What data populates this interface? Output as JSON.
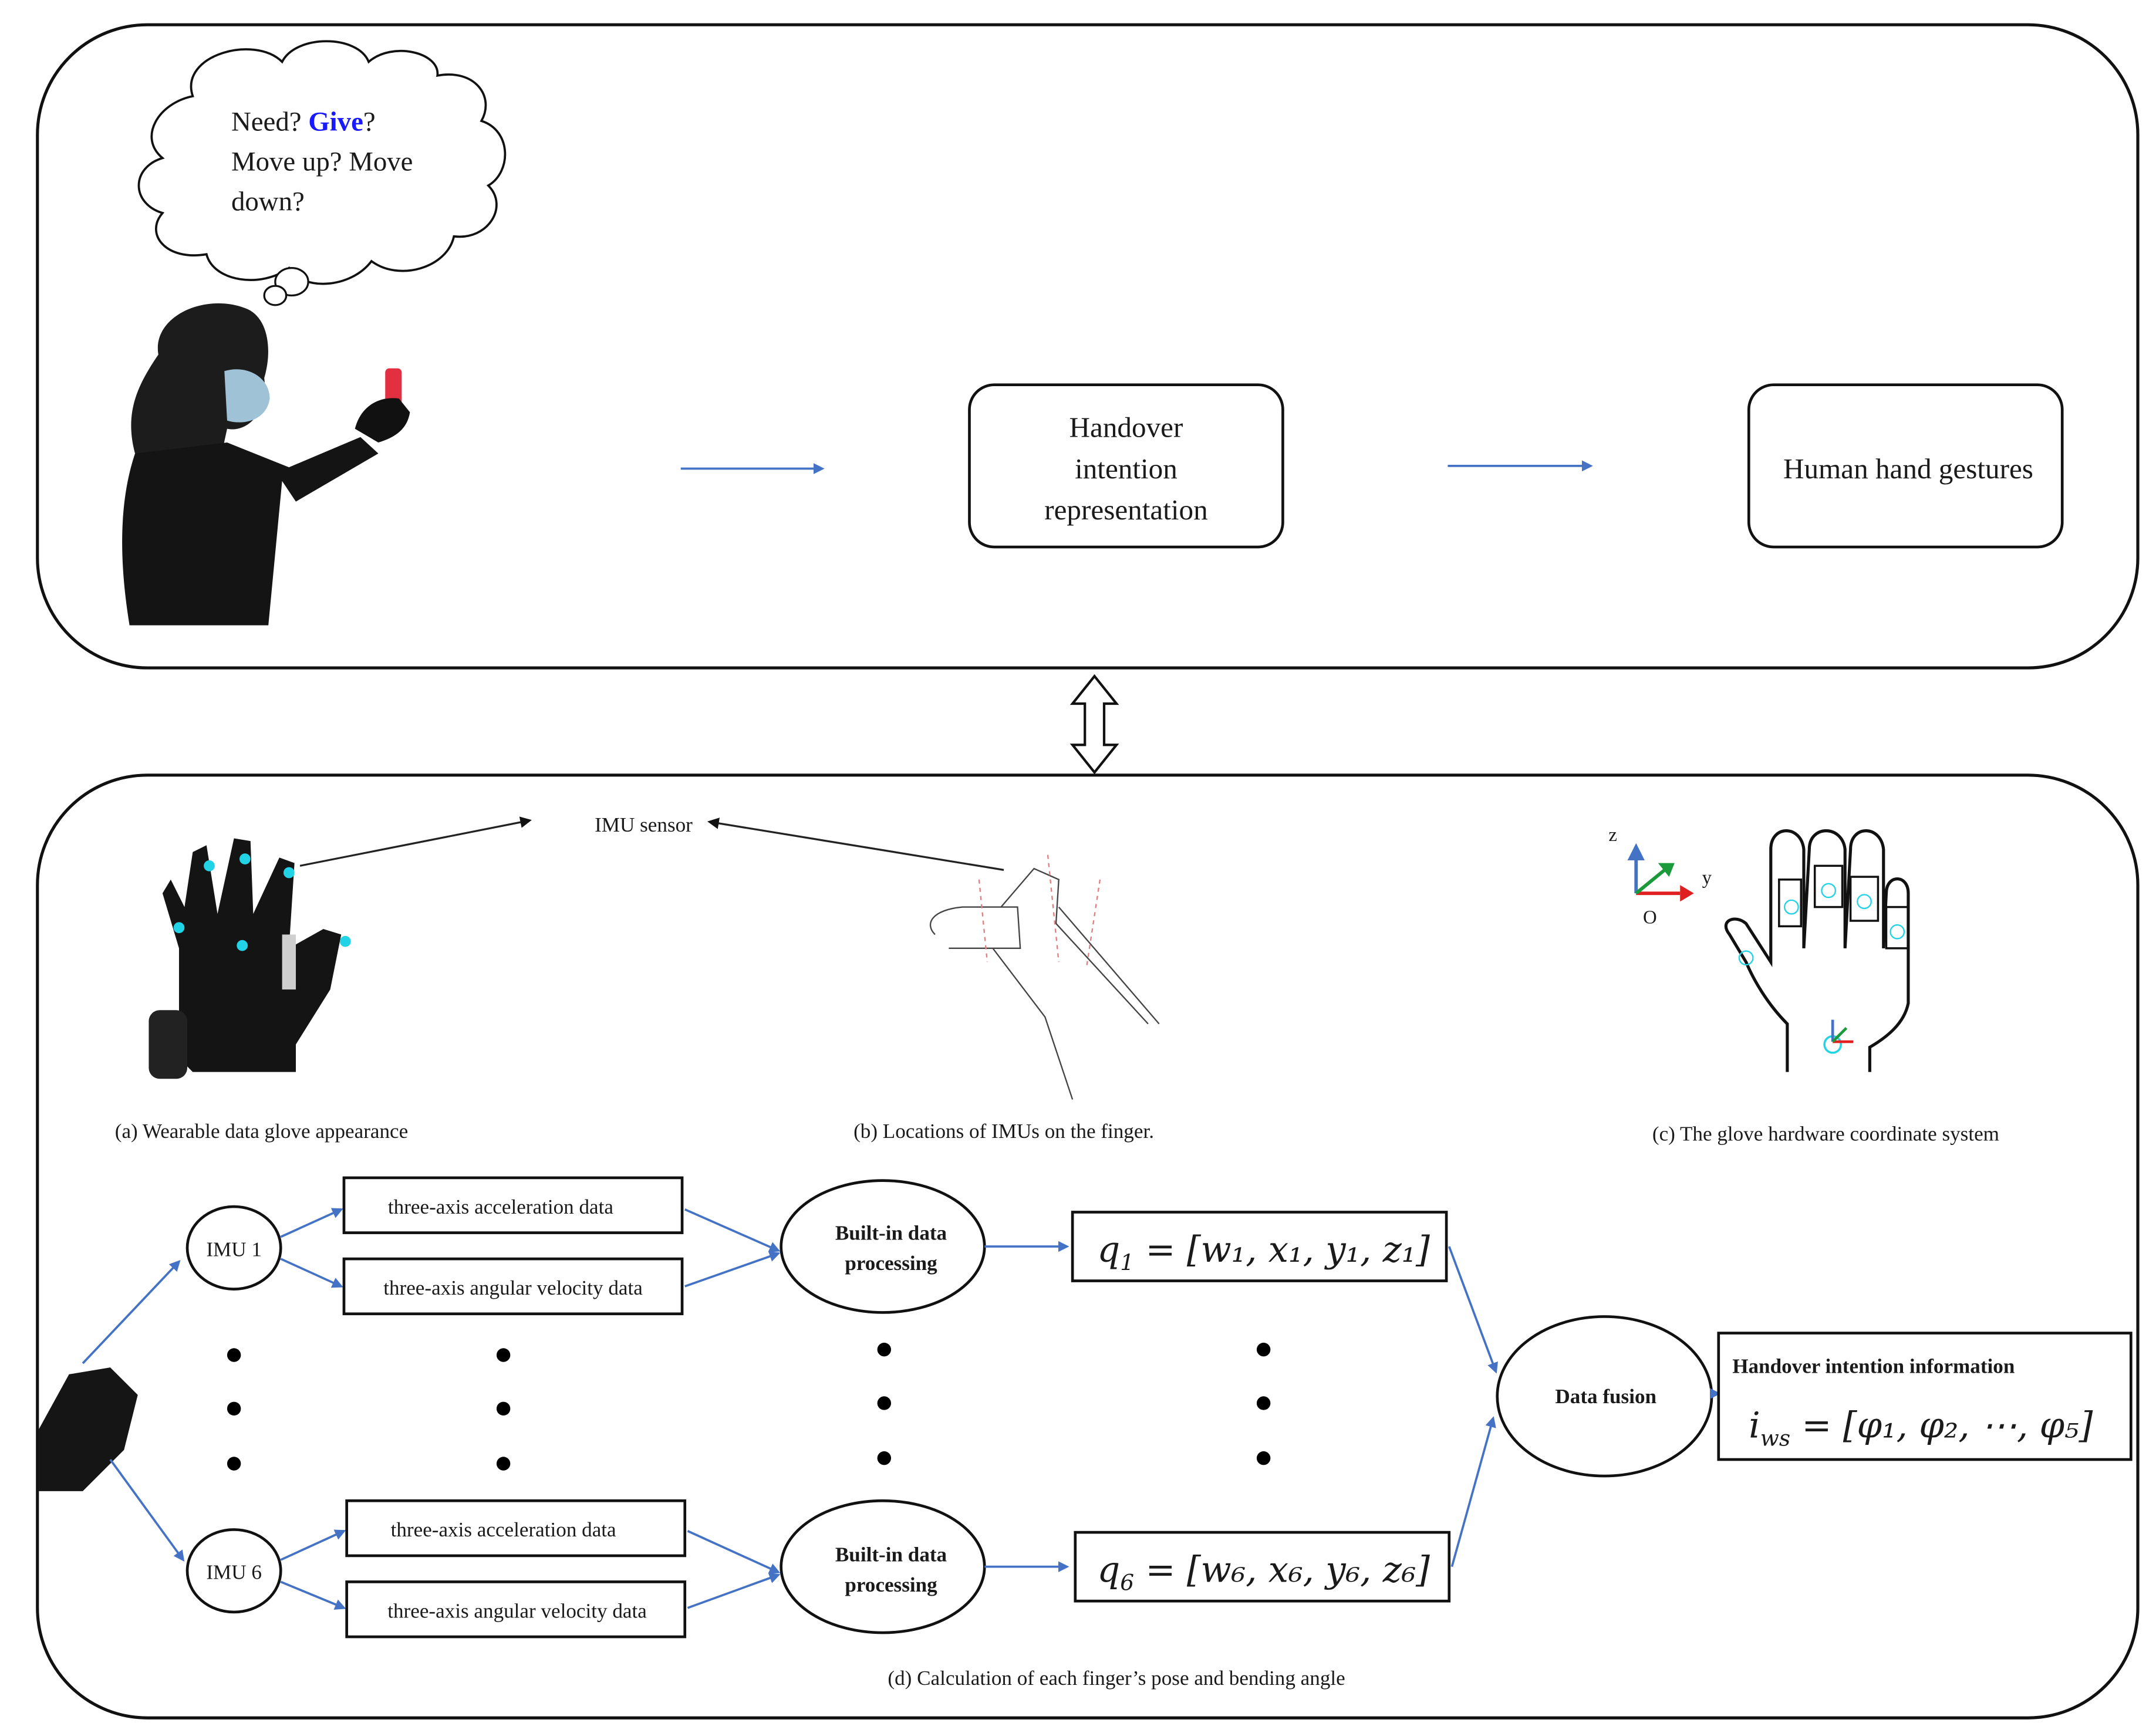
{
  "top_panel": {
    "thought_bubble": {
      "line1_prefix": "Need? ",
      "line1_highlight": "Give",
      "line1_suffix": "?",
      "line2": "Move up? Move",
      "line3": "down?",
      "highlight_color": "#1a1aff"
    },
    "box_intention": [
      "Handover",
      "intention",
      "representation"
    ],
    "box_gestures": "Human hand gestures"
  },
  "bottom_panel": {
    "imu_sensor_label": "IMU sensor",
    "captions": {
      "a": "(a) Wearable data glove appearance",
      "b": "(b) Locations of IMUs on the finger.",
      "c": "(c) The glove hardware coordinate system",
      "d": "(d) Calculation of each finger’s pose and bending angle"
    },
    "axes": {
      "z": "z",
      "y": "y",
      "origin": "O"
    },
    "pipeline": {
      "rows": [
        {
          "imu": "IMU 1",
          "accel": "three-axis acceleration data",
          "gyro": "three-axis angular velocity data",
          "processing": [
            "Built-in data",
            "processing"
          ],
          "quat_var": "q",
          "quat_sub": "1",
          "quat_rhs": "[w₁, x₁, y₁, z₁]"
        },
        {
          "imu": "IMU 6",
          "accel": "three-axis acceleration data",
          "gyro": "three-axis angular velocity data",
          "processing": [
            "Built-in data",
            "processing"
          ],
          "quat_var": "q",
          "quat_sub": "6",
          "quat_rhs": "[w₆, x₆, y₆, z₆]"
        }
      ],
      "fusion": "Data fusion",
      "output_title": "Handover intention information",
      "output_var": "i",
      "output_sub": "ws",
      "output_rhs": "[φ₁, φ₂, ⋯, φ₅]"
    }
  },
  "colors": {
    "arrow_blue": "#4472c4",
    "sensor_cyan": "#22d3e6",
    "axis_z": "#4472c4",
    "axis_y": "#e02020",
    "axis_x": "#1a9a3a"
  }
}
